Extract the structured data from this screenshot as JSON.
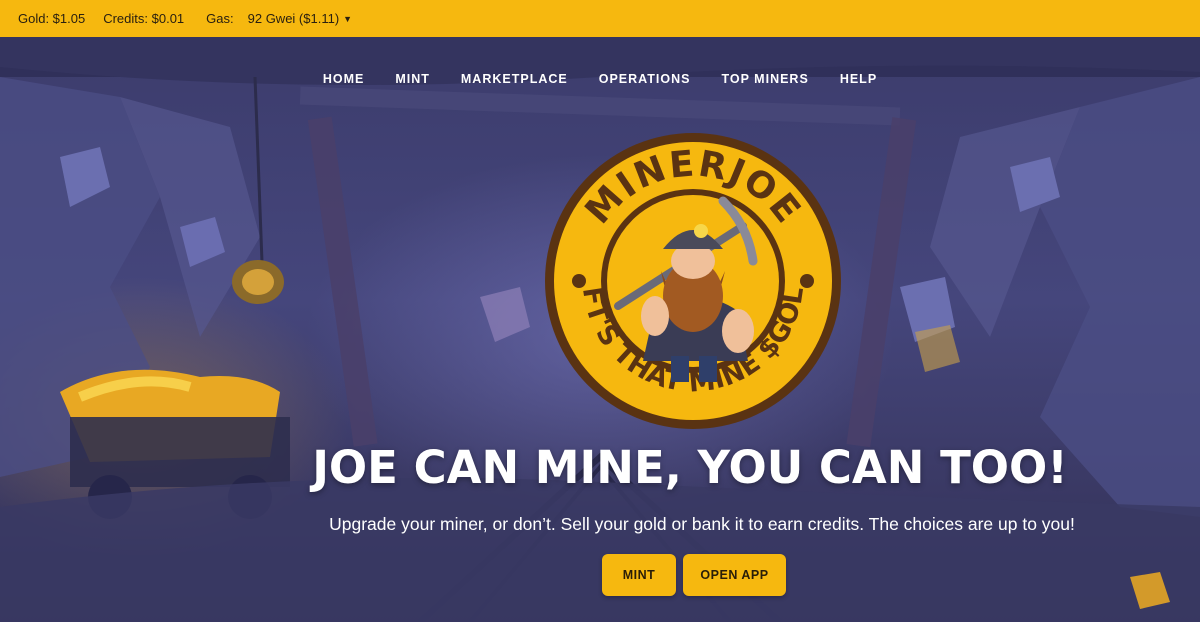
{
  "topbar": {
    "gold": "Gold: $1.05",
    "credits": "Credits: $0.01",
    "gas_label": "Gas:",
    "gas_value": "92 Gwei ($1.11)"
  },
  "nav": {
    "items": [
      {
        "label": "HOME"
      },
      {
        "label": "MINT"
      },
      {
        "label": "MARKETPLACE"
      },
      {
        "label": "OPERATIONS"
      },
      {
        "label": "TOP MINERS"
      },
      {
        "label": "HELP"
      }
    ]
  },
  "logo": {
    "name": "MINERJOE",
    "tagline": "NFT'S THAT MINE $GOLD"
  },
  "hero": {
    "headline": "JOE CAN MINE, YOU CAN TOO!",
    "subtitle": "Upgrade your miner, or don’t. Sell your gold or bank it to earn credits. The choices are up to you!",
    "buttons": {
      "mint": "MINT",
      "open_app": "OPEN APP"
    }
  },
  "colors": {
    "accent": "#f6b80f",
    "logo_rim": "#5a3312",
    "background": "#3a3b6e"
  }
}
